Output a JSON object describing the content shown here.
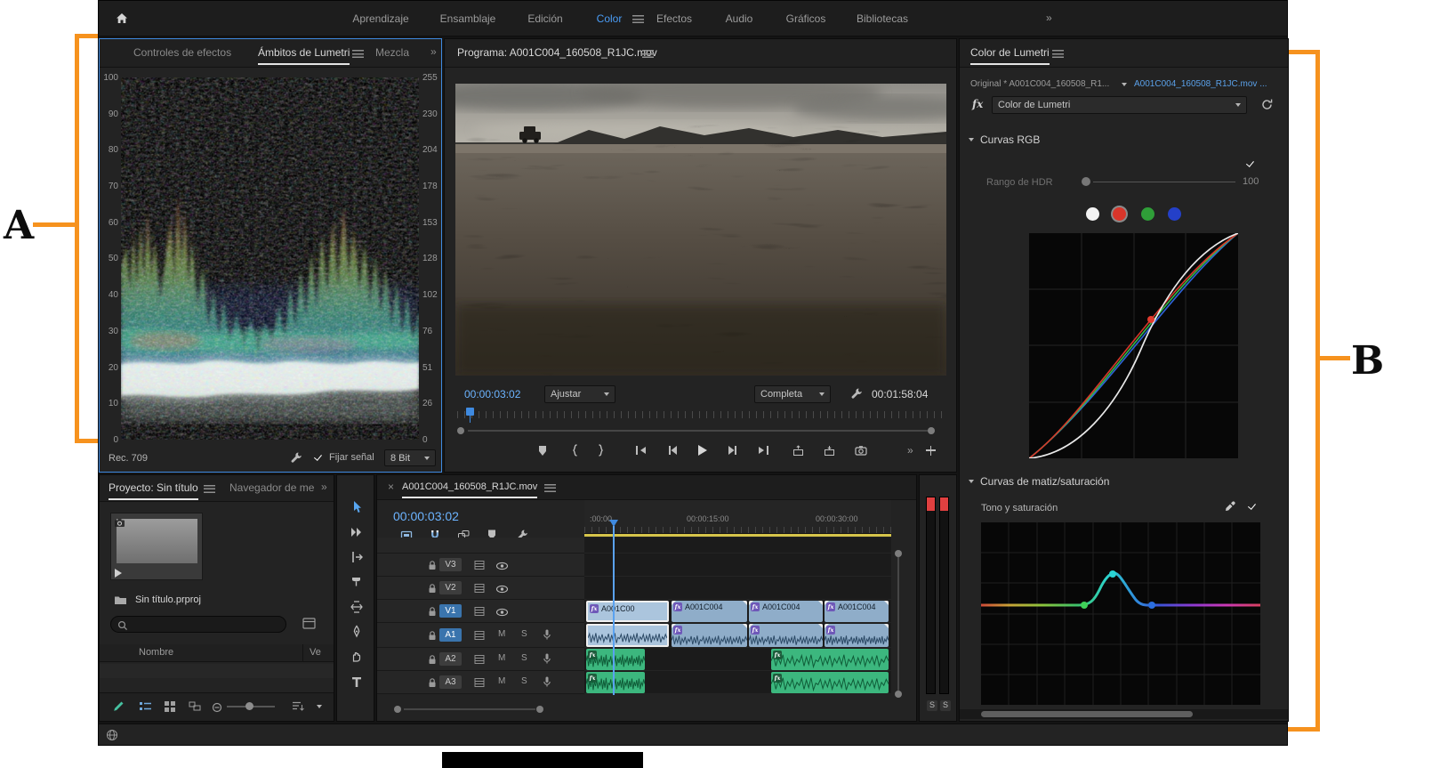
{
  "colors": {
    "accent_blue": "#3f8ae0",
    "annotation_orange": "#f6921e",
    "timecode_blue": "#6cb4ff",
    "render_bar_yellow": "#d6c44a",
    "video_clip_blue": "#8fadc9",
    "audio_clip_green": "#3cb77e"
  },
  "annotations": {
    "label_a": "A",
    "label_b": "B"
  },
  "topbar": {
    "tabs": [
      {
        "label": "Aprendizaje"
      },
      {
        "label": "Ensamblaje"
      },
      {
        "label": "Edición"
      },
      {
        "label": "Color"
      },
      {
        "label": "Efectos"
      },
      {
        "label": "Audio"
      },
      {
        "label": "Gráficos"
      },
      {
        "label": "Bibliotecas"
      }
    ],
    "active_tab": "Color",
    "overflow": "»"
  },
  "scopes": {
    "tab_effect_controls": "Controles de efectos",
    "tab_lumetri_scopes": "Ámbitos de Lumetri",
    "tab_mixer": "Mezcla",
    "overflow": "»",
    "left_scale": [
      "100",
      "90",
      "80",
      "70",
      "60",
      "50",
      "40",
      "30",
      "20",
      "10",
      "0"
    ],
    "right_scale": [
      "255",
      "230",
      "204",
      "178",
      "153",
      "128",
      "102",
      "76",
      "51",
      "26",
      "0"
    ],
    "colorspace": "Rec. 709",
    "clamp_label": "Fijar señal",
    "bit_depth": "8 Bit"
  },
  "program": {
    "title": "Programa: A001C004_160508_R1JC.mov",
    "timecode": "00:00:03:02",
    "fit_mode": "Ajustar",
    "playback_quality": "Completa",
    "duration": "00:01:58:04",
    "overflow": "»"
  },
  "lumetri": {
    "title": "Color de Lumetri",
    "master_label": "Original * A001C004_160508_R1...",
    "clip_link": "A001C004_160508_R1JC.mov ...",
    "fx_label": "fx",
    "effect_name": "Color de Lumetri",
    "section_rgb": "Curvas RGB",
    "hdr_label": "Rango de HDR",
    "hdr_value": "100",
    "section_hue_sat": "Curvas de matiz/saturación",
    "tone_sat_label": "Tono y saturación"
  },
  "project": {
    "tab_project": "Proyecto: Sin título",
    "tab_media_browser": "Navegador de me",
    "overflow": "»",
    "file_name": "Sin título.prproj",
    "col_name": "Nombre",
    "col_video": "Ve"
  },
  "timeline": {
    "close_glyph": "×",
    "tab": "A001C004_160508_R1JC.mov",
    "timecode": "00:00:03:02",
    "ruler_labels": [
      ":00:00",
      "00:00:15:00",
      "00:00:30:00"
    ],
    "video_tracks": [
      "V3",
      "V2",
      "V1"
    ],
    "audio_tracks": [
      "A1",
      "A2",
      "A3"
    ],
    "mute_label": "M",
    "solo_label": "S",
    "fx_badge": "fx",
    "v1_clips": [
      "A001C00",
      "A001C004",
      "A001C004",
      "A001C004"
    ]
  },
  "meters": {
    "solo_label": "S"
  }
}
